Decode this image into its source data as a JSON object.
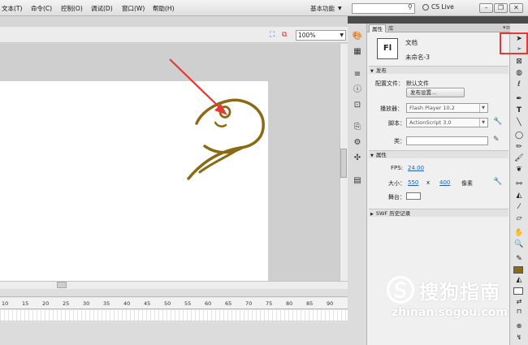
{
  "menubar": {
    "items": [
      "文本(T)",
      "命令(C)",
      "控制(O)",
      "调试(D)",
      "窗口(W)",
      "帮助(H)"
    ],
    "workspace": "基本功能",
    "cs_live": "CS Live"
  },
  "stage": {
    "zoom": "100%"
  },
  "timeline": {
    "ruler_ticks": [
      "10",
      "15",
      "20",
      "25",
      "30",
      "35",
      "40",
      "45",
      "50",
      "55",
      "60",
      "65",
      "70",
      "75",
      "80",
      "85",
      "90"
    ]
  },
  "properties": {
    "tabs": [
      "属性",
      "库"
    ],
    "doc_type": "文档",
    "doc_name": "未命名-3",
    "doc_icon": "Fl",
    "publish": {
      "header": "发布",
      "profile_label": "配置文件：",
      "profile_value": "默认文件",
      "settings_button": "发布设置...",
      "player_label": "播放器：",
      "player_value": "Flash Player 10.2",
      "script_label": "脚本：",
      "script_value": "ActionScript 3.0",
      "class_label": "类："
    },
    "props": {
      "header": "属性",
      "fps_label": "FPS:",
      "fps_value": "24.00",
      "size_label": "大小：",
      "width": "550",
      "x_sep": "x",
      "height": "400",
      "unit": "像素",
      "stage_label": "舞台："
    },
    "history": {
      "header": "SWF 历史记录"
    }
  },
  "colors": {
    "stroke": "#8b6a14",
    "fill": "#ffffff",
    "highlight": "#e53935"
  },
  "watermark": {
    "text": "搜狗指南",
    "url": "zhinan.sogou.com"
  }
}
